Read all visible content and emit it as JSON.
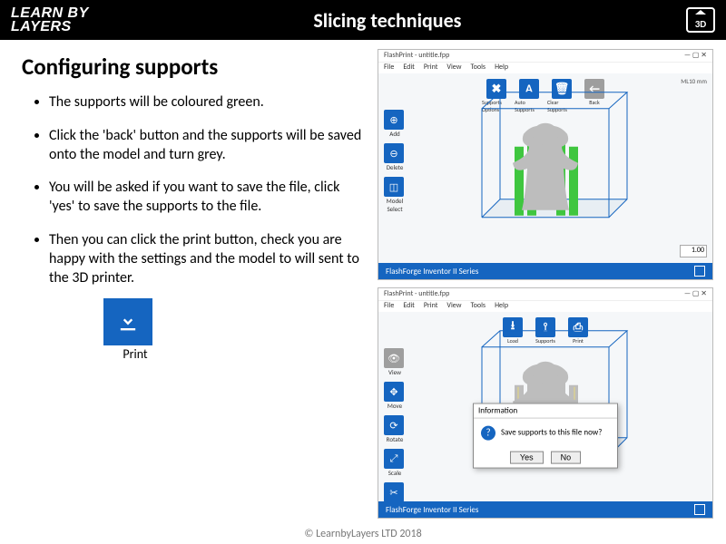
{
  "header": {
    "logo_line1": "LEARN BY",
    "logo_line2": "LAYERS",
    "title": "Slicing techniques",
    "badge": "3D"
  },
  "subtitle": "Configuring supports",
  "bullets": [
    "The supports will be coloured green.",
    "Click the 'back' button and the supports will be saved onto the model and turn grey.",
    "You will be asked if you want to save the file, click 'yes' to save the supports to the file.",
    "Then you can click the print button, check you are happy with the settings and the model to will sent to the 3D printer."
  ],
  "print_label": "Print",
  "shot1": {
    "window_title": "FlashPrint - untitle.fpp",
    "menu": [
      "File",
      "Edit",
      "Print",
      "View",
      "Tools",
      "Help"
    ],
    "scale_label": "ML10 mm",
    "top_tools": [
      {
        "glyph": "✖",
        "label": "Supports Options"
      },
      {
        "glyph": "A",
        "label": "Auto Supports"
      },
      {
        "glyph": "🗑",
        "label": "Clear Supports"
      },
      {
        "glyph": "←",
        "label": "Back",
        "dim": true
      }
    ],
    "side_tools": [
      {
        "glyph": "⊕",
        "label": "Add"
      },
      {
        "glyph": "⊖",
        "label": "Delete"
      },
      {
        "glyph": "◫",
        "label": "Model Select"
      }
    ],
    "zoom": "1.00",
    "status": "FlashForge Inventor II Series"
  },
  "shot2": {
    "window_title": "FlashPrint - untitle.fpp",
    "menu": [
      "File",
      "Edit",
      "Print",
      "View",
      "Tools",
      "Help"
    ],
    "top_tools": [
      {
        "glyph": "⭳",
        "label": "Load"
      },
      {
        "glyph": "⟟",
        "label": "Supports"
      },
      {
        "glyph": "⎙",
        "label": "Print"
      }
    ],
    "side_tools": [
      {
        "glyph": "👁",
        "label": "View",
        "dim": true
      },
      {
        "glyph": "✥",
        "label": "Move"
      },
      {
        "glyph": "⟳",
        "label": "Rotate"
      },
      {
        "glyph": "⤢",
        "label": "Scale"
      },
      {
        "glyph": "✂",
        "label": "Cut"
      }
    ],
    "dialog": {
      "title": "Information",
      "text": "Save supports to this file now?",
      "yes": "Yes",
      "no": "No"
    },
    "status": "FlashForge Inventor II Series"
  },
  "copyright": "© LearnbyLayers LTD 2018"
}
